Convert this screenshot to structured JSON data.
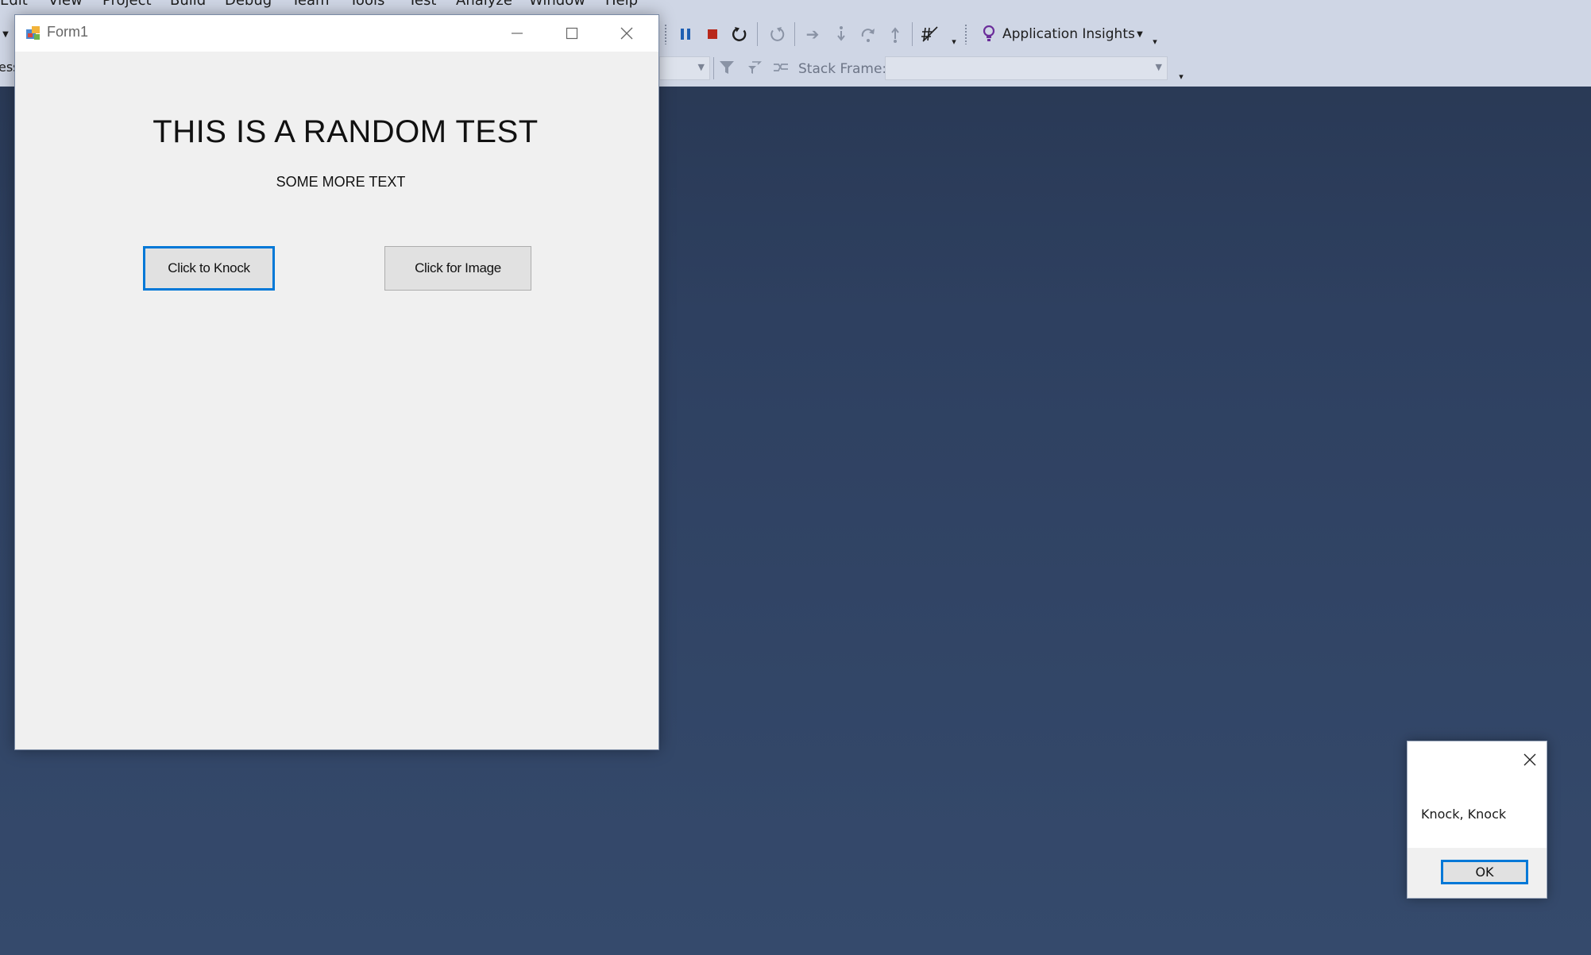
{
  "vs": {
    "menu": [
      "Edit",
      "View",
      "Project",
      "Build",
      "Debug",
      "Team",
      "Tools",
      "Test",
      "Analyze",
      "Window",
      "Help"
    ],
    "left_clip_text": "ess",
    "icons": {
      "pause": "pause-icon",
      "stop": "stop-icon",
      "restart": "restart-icon",
      "step_into": "step-into-icon",
      "step_over": "step-over-icon",
      "step_out": "step-out-icon",
      "app_insights": "lightbulb-icon"
    },
    "app_insights_label": "Application Insights",
    "stack_frame_label": "Stack Frame:",
    "stack_frame_value": ""
  },
  "form1": {
    "title": "Form1",
    "heading": "THIS IS A RANDOM TEST",
    "subtext": "SOME MORE TEXT",
    "knock_button": "Click to Knock",
    "image_button": "Click for Image"
  },
  "msgbox": {
    "message": "Knock, Knock",
    "ok_label": "OK"
  },
  "colors": {
    "desktop": "#2e4060",
    "vs_toolbar": "#cfd6e5",
    "focus_blue": "#0078d7",
    "stop_red": "#b8271a",
    "pause_blue": "#1e5fb3",
    "insights_purple": "#6b2d9a"
  }
}
